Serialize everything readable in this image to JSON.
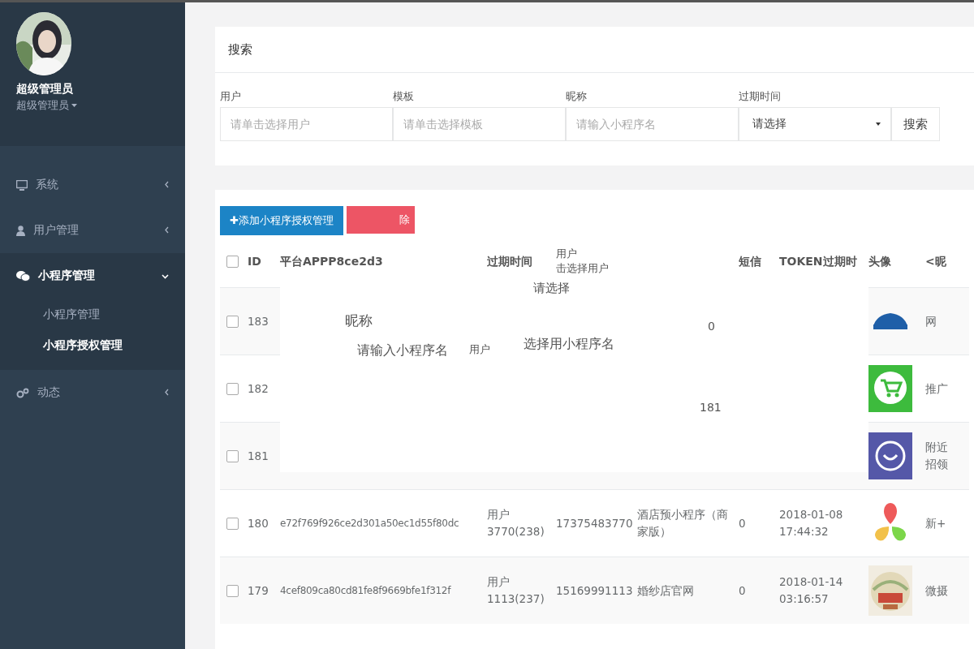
{
  "sidebar": {
    "profile": {
      "name": "超级管理员",
      "role": "超级管理员"
    },
    "menu": [
      {
        "label": "系统",
        "expanded": false
      },
      {
        "label": "用户管理",
        "expanded": false
      },
      {
        "label": "小程序管理",
        "expanded": true,
        "children": [
          {
            "label": "小程序管理",
            "selected": false
          },
          {
            "label": "小程序授权管理",
            "selected": true
          }
        ]
      },
      {
        "label": "动态",
        "expanded": false
      }
    ]
  },
  "search": {
    "title": "搜索",
    "fields": [
      {
        "kind": "input",
        "label": "用户",
        "placeholder": "请单击选择用户"
      },
      {
        "kind": "input",
        "label": "模板",
        "placeholder": "请单击选择模板"
      },
      {
        "kind": "input",
        "label": "昵称",
        "placeholder": "请输入小程序名"
      },
      {
        "kind": "select",
        "label": "过期时间",
        "value": "请选择"
      }
    ],
    "button": "搜索"
  },
  "toolbar": {
    "add_button": "✚添加小程序授权管理",
    "delete_button": "除"
  },
  "table": {
    "columns": [
      {
        "label": "ID"
      },
      {
        "label": "平台APPP8ce2d3"
      },
      {
        "label": "过期时间"
      },
      {
        "label": "用户",
        "sublabel": "击选择用户"
      },
      {
        "label": "短信"
      },
      {
        "label": "TOKEN过期时"
      },
      {
        "label": "头像"
      },
      {
        "label": "<昵"
      }
    ],
    "header_checked": false,
    "rows": [
      {
        "checked": false,
        "id": "183",
        "avatar": {
          "kind": "car"
        },
        "nickname": "网"
      },
      {
        "checked": false,
        "id": "182",
        "avatar": {
          "kind": "cart"
        },
        "nickname": "推广"
      },
      {
        "checked": false,
        "id": "181",
        "avatar": {
          "kind": "smile"
        },
        "nickname": "附近招领"
      },
      {
        "checked": false,
        "id": "180",
        "appid": "e72f769f926ce2d301a50ec1d55f80dc",
        "user": "用户 3770(238)",
        "phone": "17375483770",
        "name": "酒店预小程序（商家版）",
        "sms": "0",
        "token_expire": "2018-01-08 17:44:32",
        "avatar": {
          "kind": "petals"
        },
        "nickname": "新+"
      },
      {
        "checked": false,
        "id": "179",
        "appid": "4cef809ca80cd81fe8f9669bfe1f312f",
        "user": "用户 1113(237)",
        "phone": "15169991113",
        "name": "婚纱店官网",
        "sms": "0",
        "token_expire": "2018-01-14 03:16:57",
        "nickname": "微摄"
      }
    ]
  },
  "overlay": {
    "fragments": [
      "请选择",
      "昵称",
      "0",
      "请输入小程序名",
      "用户",
      "选择用小程序名",
      "181"
    ]
  }
}
